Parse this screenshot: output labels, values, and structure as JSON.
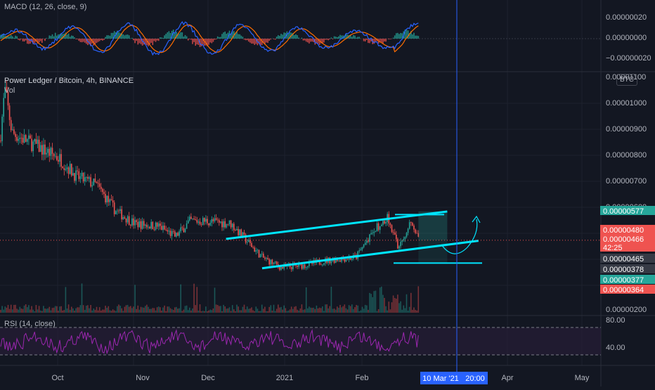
{
  "colors": {
    "background": "#131722",
    "grid": "#1e222d",
    "up": "#26a69a",
    "down": "#ef5350",
    "macd_line": "#2962ff",
    "signal_line": "#ff6d00",
    "rsi_line": "#9c27b0",
    "rsi_band": "#2a1e3a",
    "channel": "#00e5ff",
    "crosshair": "#2962ff",
    "text": "#b2b5be"
  },
  "header": {
    "macd_label": "MACD (12, 26, close, 9)",
    "title": "Power Ledger / Bitcoin, 4h, BINANCE",
    "volume_label": "Vol",
    "rsi_label": "RSI (14, close)",
    "currency_badge": "BTC"
  },
  "macd_axis": {
    "ticks": [
      "0.00000020",
      "0.00000000",
      "−0.00000020"
    ]
  },
  "price_axis": {
    "ticks": [
      "0.00001100",
      "0.00001000",
      "0.00000900",
      "0.00000800",
      "0.00000700",
      "0.00000600",
      "0.00000200"
    ]
  },
  "price_tags": [
    {
      "text": "0.00000577",
      "bg": "#26a69a"
    },
    {
      "text": "0.00000480",
      "bg": "#ef5350"
    },
    {
      "text": "0.00000466",
      "bg": "#ef5350"
    },
    {
      "text": "42:25",
      "bg": "#ef5350"
    },
    {
      "text": "0.00000465",
      "bg": "#363a45"
    },
    {
      "text": "0.00000378",
      "bg": "#363a45"
    },
    {
      "text": "0.00000377",
      "bg": "#26a69a"
    },
    {
      "text": "0.00000364",
      "bg": "#ef5350"
    }
  ],
  "rsi_axis": {
    "ticks": [
      "80.00",
      "40.00"
    ]
  },
  "time_axis": {
    "ticks": [
      "Oct",
      "Nov",
      "Dec",
      "2021",
      "Feb",
      "Apr",
      "May"
    ],
    "crosshair_date": "10 Mar '21",
    "crosshair_time": "20:00"
  },
  "chart_data": {
    "type": "candlestick",
    "symbol": "Power Ledger / Bitcoin",
    "interval": "4h",
    "exchange": "BINANCE",
    "price_range": [
      2e-06,
      1.1e-05
    ],
    "series": [
      {
        "points": [
          [
            "2020-09-10",
            8.5e-06
          ],
          [
            "2020-09-12",
            1.05e-05
          ],
          [
            "2020-09-15",
            8.8e-06
          ],
          [
            "2020-09-25",
            8.3e-06
          ],
          [
            "2020-10-05",
            7.8e-06
          ],
          [
            "2020-10-12",
            7.1e-06
          ],
          [
            "2020-10-20",
            6.8e-06
          ],
          [
            "2020-10-28",
            5.8e-06
          ],
          [
            "2020-11-05",
            5.3e-06
          ],
          [
            "2020-11-15",
            5.2e-06
          ],
          [
            "2020-11-22",
            4.8e-06
          ],
          [
            "2020-11-28",
            5.4e-06
          ],
          [
            "2020-12-05",
            5.4e-06
          ],
          [
            "2020-12-15",
            5.3e-06
          ],
          [
            "2020-12-22",
            4.6e-06
          ],
          [
            "2020-12-28",
            4e-06
          ],
          [
            "2021-01-05",
            3.6e-06
          ],
          [
            "2021-01-15",
            3.7e-06
          ],
          [
            "2021-01-25",
            3.9e-06
          ],
          [
            "2021-02-05",
            4e-06
          ],
          [
            "2021-02-12",
            5e-06
          ],
          [
            "2021-02-18",
            5.6e-06
          ],
          [
            "2021-02-23",
            4.3e-06
          ],
          [
            "2021-02-28",
            5.5e-06
          ],
          [
            "2021-03-03",
            4.66e-06
          ]
        ]
      }
    ],
    "channel_upper": [
      [
        "2020-12-13",
        4.71e-06
      ],
      [
        "2021-03-15",
        5.77e-06
      ]
    ],
    "channel_lower": [
      [
        "2020-12-28",
        3.58e-06
      ],
      [
        "2021-03-28",
        4.64e-06
      ]
    ],
    "horizontal_levels": [
      5.65e-06,
      4.8e-06,
      3.78e-06
    ],
    "projection_box": {
      "from": "2021-03-03",
      "to": "2021-03-15",
      "top": 5.77e-06,
      "bottom": 3.77e-06
    },
    "crosshair_x": "2021-03-10 20:00",
    "x_axis_ticks": [
      "Oct",
      "Nov",
      "Dec",
      "2021",
      "Feb",
      "Apr",
      "May"
    ],
    "macd": {
      "label": "MACD (12, 26, close, 9)",
      "ylim": [
        -3e-07,
        3e-07
      ]
    },
    "rsi": {
      "label": "RSI (14, close)",
      "bands": [
        70,
        30
      ],
      "ylim": [
        20,
        85
      ]
    },
    "grid": true
  }
}
